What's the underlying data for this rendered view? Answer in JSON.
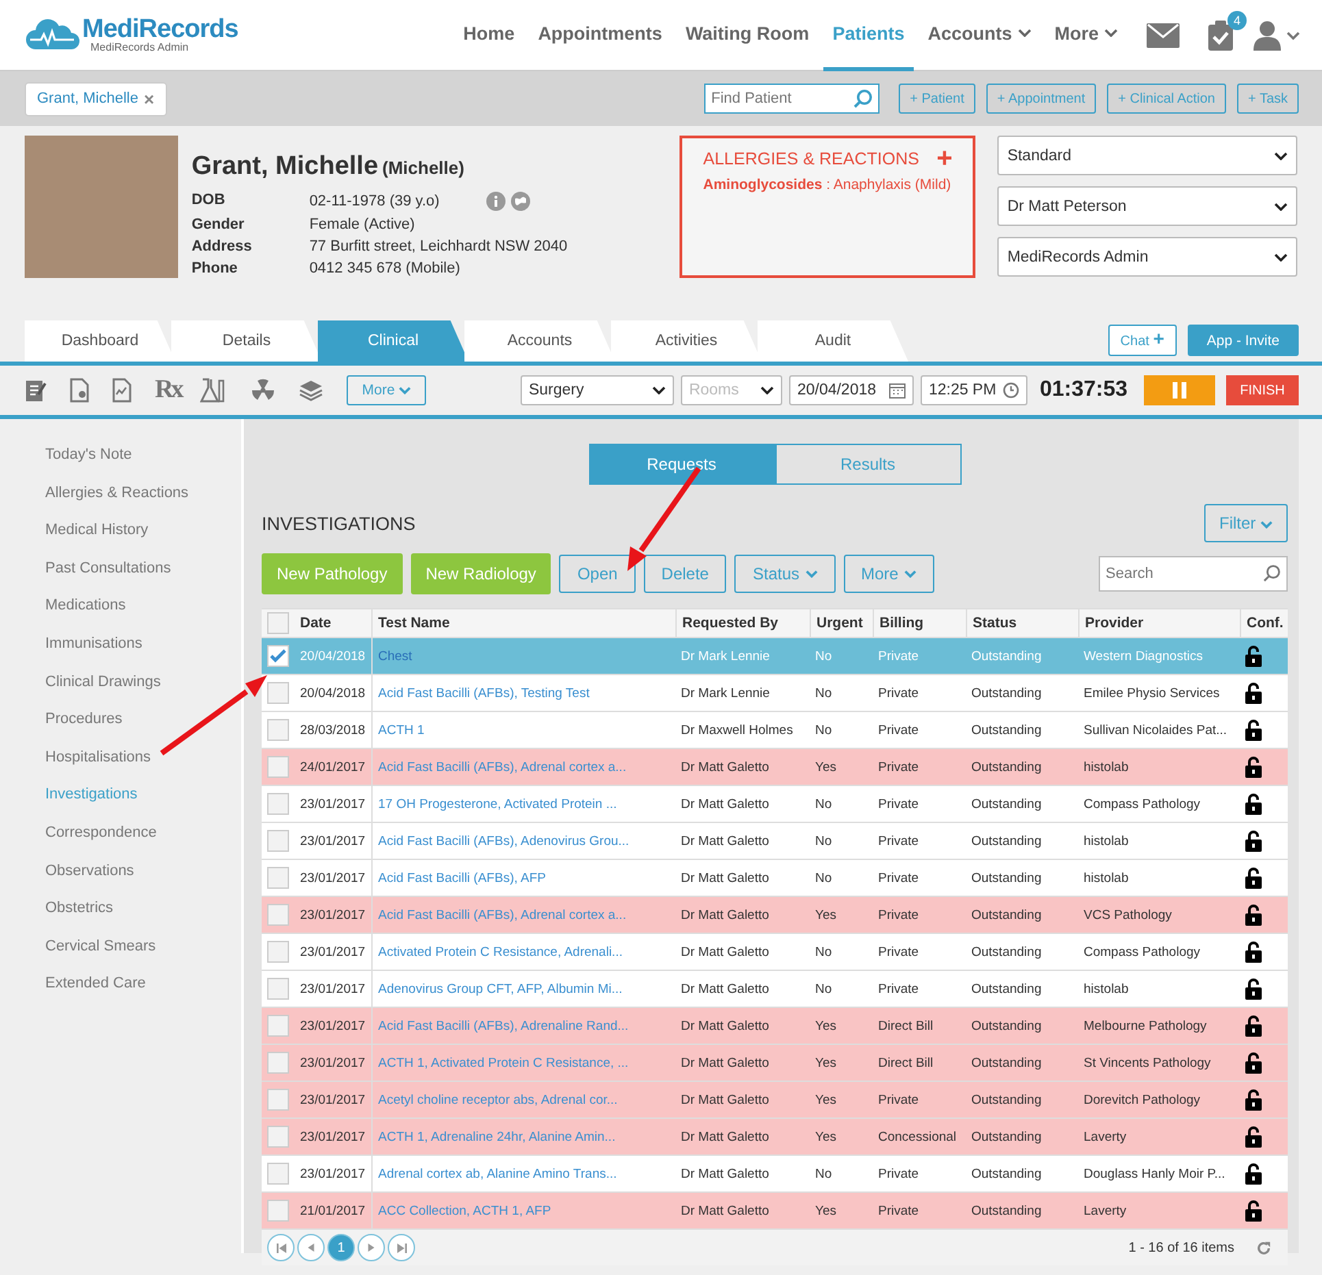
{
  "header": {
    "logo": "MediRecords",
    "logo_subtitle": "MediRecords Admin",
    "nav": [
      {
        "label": "Home",
        "selected": false,
        "dropdown": false
      },
      {
        "label": "Appointments",
        "selected": false,
        "dropdown": false
      },
      {
        "label": "Waiting Room",
        "selected": false,
        "dropdown": false
      },
      {
        "label": "Patients",
        "selected": true,
        "dropdown": false
      },
      {
        "label": "Accounts",
        "selected": false,
        "dropdown": true
      },
      {
        "label": "More",
        "selected": false,
        "dropdown": true
      }
    ],
    "tasks_badge": "4"
  },
  "patient_bar": {
    "tag": "Grant, Michelle",
    "tag_close": "×",
    "find_placeholder": "Find Patient",
    "actions": [
      "+ Patient",
      "+ Appointment",
      "+ Clinical Action",
      "+ Task"
    ]
  },
  "patient": {
    "name": "Grant, Michelle",
    "preferred_name": "(Michelle)",
    "fields": [
      {
        "label": "DOB",
        "value": "02-11-1978 (39 y.o)"
      },
      {
        "label": "Gender",
        "value": "Female (Active)"
      },
      {
        "label": "Address",
        "value": "77 Burfitt street, Leichhardt NSW 2040"
      },
      {
        "label": "Phone",
        "value": "0412 345 678 (Mobile)"
      }
    ],
    "allergies": {
      "title": "ALLERGIES & REACTIONS",
      "add": "+",
      "items": [
        {
          "substance": "Aminoglycosides",
          "reaction": " : Anaphylaxis (Mild)"
        }
      ]
    },
    "selects": [
      "Standard",
      "Dr Matt Peterson",
      "MediRecords Admin"
    ]
  },
  "tabs": [
    {
      "label": "Dashboard",
      "selected": false
    },
    {
      "label": "Details",
      "selected": false
    },
    {
      "label": "Clinical",
      "selected": true
    },
    {
      "label": "Accounts",
      "selected": false
    },
    {
      "label": "Activities",
      "selected": false
    },
    {
      "label": "Audit",
      "selected": false
    }
  ],
  "tab_actions": {
    "chat": "Chat",
    "chat_add": "+",
    "invite": "App - Invite"
  },
  "toolbar": {
    "rx": "Rx",
    "more": "More",
    "location": "Surgery",
    "rooms_placeholder": "Rooms",
    "date": "20/04/2018",
    "time": "12:25 PM",
    "timer": "01:37:53",
    "finish": "FINISH"
  },
  "sidebar": {
    "items": [
      {
        "label": "Today's Note",
        "selected": false
      },
      {
        "label": "Allergies & Reactions",
        "selected": false
      },
      {
        "label": "Medical History",
        "selected": false
      },
      {
        "label": "Past Consultations",
        "selected": false
      },
      {
        "label": "Medications",
        "selected": false
      },
      {
        "label": "Immunisations",
        "selected": false
      },
      {
        "label": "Clinical Drawings",
        "selected": false
      },
      {
        "label": "Procedures",
        "selected": false
      },
      {
        "label": "Hospitalisations",
        "selected": false
      },
      {
        "label": "Investigations",
        "selected": true
      },
      {
        "label": "Correspondence",
        "selected": false
      },
      {
        "label": "Observations",
        "selected": false
      },
      {
        "label": "Obstetrics",
        "selected": false
      },
      {
        "label": "Cervical Smears",
        "selected": false
      },
      {
        "label": "Extended Care",
        "selected": false
      }
    ]
  },
  "investigations": {
    "toggle": [
      {
        "label": "Requests",
        "selected": true
      },
      {
        "label": "Results",
        "selected": false
      }
    ],
    "title": "INVESTIGATIONS",
    "filter": "Filter",
    "search_placeholder": "Search",
    "buttons": [
      {
        "label": "New Pathology",
        "kind": "primary",
        "dropdown": false
      },
      {
        "label": "New Radiology",
        "kind": "primary",
        "dropdown": false
      },
      {
        "label": "Open",
        "kind": "outline",
        "dropdown": false
      },
      {
        "label": "Delete",
        "kind": "outline",
        "dropdown": false
      },
      {
        "label": "Status",
        "kind": "outline",
        "dropdown": true
      },
      {
        "label": "More",
        "kind": "outline",
        "dropdown": true
      }
    ],
    "columns": [
      "Date",
      "Test Name",
      "Requested By",
      "Urgent",
      "Billing",
      "Status",
      "Provider",
      "Conf."
    ],
    "header_checked": false,
    "rows": [
      {
        "date": "20/04/2018",
        "test": "Chest",
        "requested_by": "Dr Mark Lennie",
        "urgent": "No",
        "billing": "Private",
        "status": "Outstanding",
        "provider": "Western Diagnostics",
        "highlighted": false,
        "selected": true,
        "checked": true
      },
      {
        "date": "20/04/2018",
        "test": "Acid Fast Bacilli (AFBs), Testing Test",
        "requested_by": "Dr Mark Lennie",
        "urgent": "No",
        "billing": "Private",
        "status": "Outstanding",
        "provider": "Emilee Physio Services",
        "highlighted": false,
        "selected": false,
        "checked": false
      },
      {
        "date": "28/03/2018",
        "test": "ACTH 1",
        "requested_by": "Dr Maxwell Holmes",
        "urgent": "No",
        "billing": "Private",
        "status": "Outstanding",
        "provider": "Sullivan Nicolaides Pat...",
        "highlighted": false,
        "selected": false,
        "checked": false
      },
      {
        "date": "24/01/2017",
        "test": "Acid Fast Bacilli (AFBs), Adrenal cortex a...",
        "requested_by": "Dr Matt Galetto",
        "urgent": "Yes",
        "billing": "Private",
        "status": "Outstanding",
        "provider": "histolab",
        "highlighted": true,
        "selected": false,
        "checked": false
      },
      {
        "date": "23/01/2017",
        "test": "17 OH Progesterone, Activated Protein ...",
        "requested_by": "Dr Matt Galetto",
        "urgent": "No",
        "billing": "Private",
        "status": "Outstanding",
        "provider": "Compass Pathology",
        "highlighted": false,
        "selected": false,
        "checked": false
      },
      {
        "date": "23/01/2017",
        "test": "Acid Fast Bacilli (AFBs), Adenovirus Grou...",
        "requested_by": "Dr Matt Galetto",
        "urgent": "No",
        "billing": "Private",
        "status": "Outstanding",
        "provider": "histolab",
        "highlighted": false,
        "selected": false,
        "checked": false
      },
      {
        "date": "23/01/2017",
        "test": "Acid Fast Bacilli (AFBs), AFP",
        "requested_by": "Dr Matt Galetto",
        "urgent": "No",
        "billing": "Private",
        "status": "Outstanding",
        "provider": "histolab",
        "highlighted": false,
        "selected": false,
        "checked": false
      },
      {
        "date": "23/01/2017",
        "test": "Acid Fast Bacilli (AFBs), Adrenal cortex a...",
        "requested_by": "Dr Matt Galetto",
        "urgent": "Yes",
        "billing": "Private",
        "status": "Outstanding",
        "provider": "VCS Pathology",
        "highlighted": true,
        "selected": false,
        "checked": false
      },
      {
        "date": "23/01/2017",
        "test": "Activated Protein C Resistance, Adrenali...",
        "requested_by": "Dr Matt Galetto",
        "urgent": "No",
        "billing": "Private",
        "status": "Outstanding",
        "provider": "Compass Pathology",
        "highlighted": false,
        "selected": false,
        "checked": false
      },
      {
        "date": "23/01/2017",
        "test": "Adenovirus Group CFT, AFP, Albumin Mi...",
        "requested_by": "Dr Matt Galetto",
        "urgent": "No",
        "billing": "Private",
        "status": "Outstanding",
        "provider": "histolab",
        "highlighted": false,
        "selected": false,
        "checked": false
      },
      {
        "date": "23/01/2017",
        "test": "Acid Fast Bacilli (AFBs), Adrenaline Rand...",
        "requested_by": "Dr Matt Galetto",
        "urgent": "Yes",
        "billing": "Direct Bill",
        "status": "Outstanding",
        "provider": "Melbourne Pathology",
        "highlighted": true,
        "selected": false,
        "checked": false
      },
      {
        "date": "23/01/2017",
        "test": "ACTH 1, Activated Protein C Resistance, ...",
        "requested_by": "Dr Matt Galetto",
        "urgent": "Yes",
        "billing": "Direct Bill",
        "status": "Outstanding",
        "provider": "St Vincents Pathology",
        "highlighted": true,
        "selected": false,
        "checked": false
      },
      {
        "date": "23/01/2017",
        "test": "Acetyl choline receptor abs, Adrenal cor...",
        "requested_by": "Dr Matt Galetto",
        "urgent": "Yes",
        "billing": "Private",
        "status": "Outstanding",
        "provider": "Dorevitch Pathology",
        "highlighted": true,
        "selected": false,
        "checked": false
      },
      {
        "date": "23/01/2017",
        "test": "ACTH 1, Adrenaline 24hr, Alanine Amin...",
        "requested_by": "Dr Matt Galetto",
        "urgent": "Yes",
        "billing": "Concessional",
        "status": "Outstanding",
        "provider": "Laverty",
        "highlighted": true,
        "selected": false,
        "checked": false
      },
      {
        "date": "23/01/2017",
        "test": "Adrenal cortex ab, Alanine Amino Trans...",
        "requested_by": "Dr Matt Galetto",
        "urgent": "No",
        "billing": "Private",
        "status": "Outstanding",
        "provider": "Douglass Hanly Moir P...",
        "highlighted": false,
        "selected": false,
        "checked": false
      },
      {
        "date": "21/01/2017",
        "test": "ACC Collection, ACTH 1, AFP",
        "requested_by": "Dr Matt Galetto",
        "urgent": "Yes",
        "billing": "Private",
        "status": "Outstanding",
        "provider": "Laverty",
        "highlighted": true,
        "selected": false,
        "checked": false
      }
    ],
    "pages": [
      {
        "label": "1",
        "selected": true
      }
    ],
    "summary": "1 - 16 of 16 items"
  }
}
